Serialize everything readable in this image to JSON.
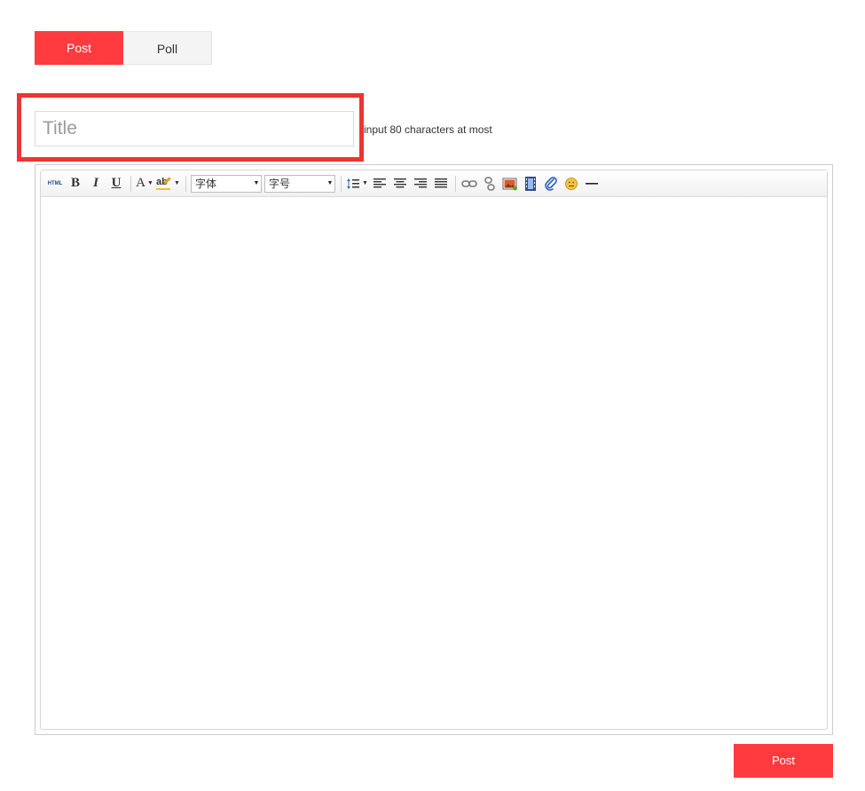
{
  "tabs": [
    {
      "label": "Post",
      "active": true
    },
    {
      "label": "Poll",
      "active": false
    }
  ],
  "title_field": {
    "placeholder": "Title",
    "value": ""
  },
  "title_hint": "input 80 characters at most",
  "toolbar": {
    "html_label": "HTML",
    "bold": "B",
    "italic": "I",
    "underline": "U",
    "font_color": "A",
    "highlight": "ab",
    "font_family": "字体",
    "font_size": "字号"
  },
  "editor": {
    "content": ""
  },
  "submit_label": "Post",
  "colors": {
    "accent": "#ff3b3f",
    "highlight_frame": "#ee3434"
  }
}
